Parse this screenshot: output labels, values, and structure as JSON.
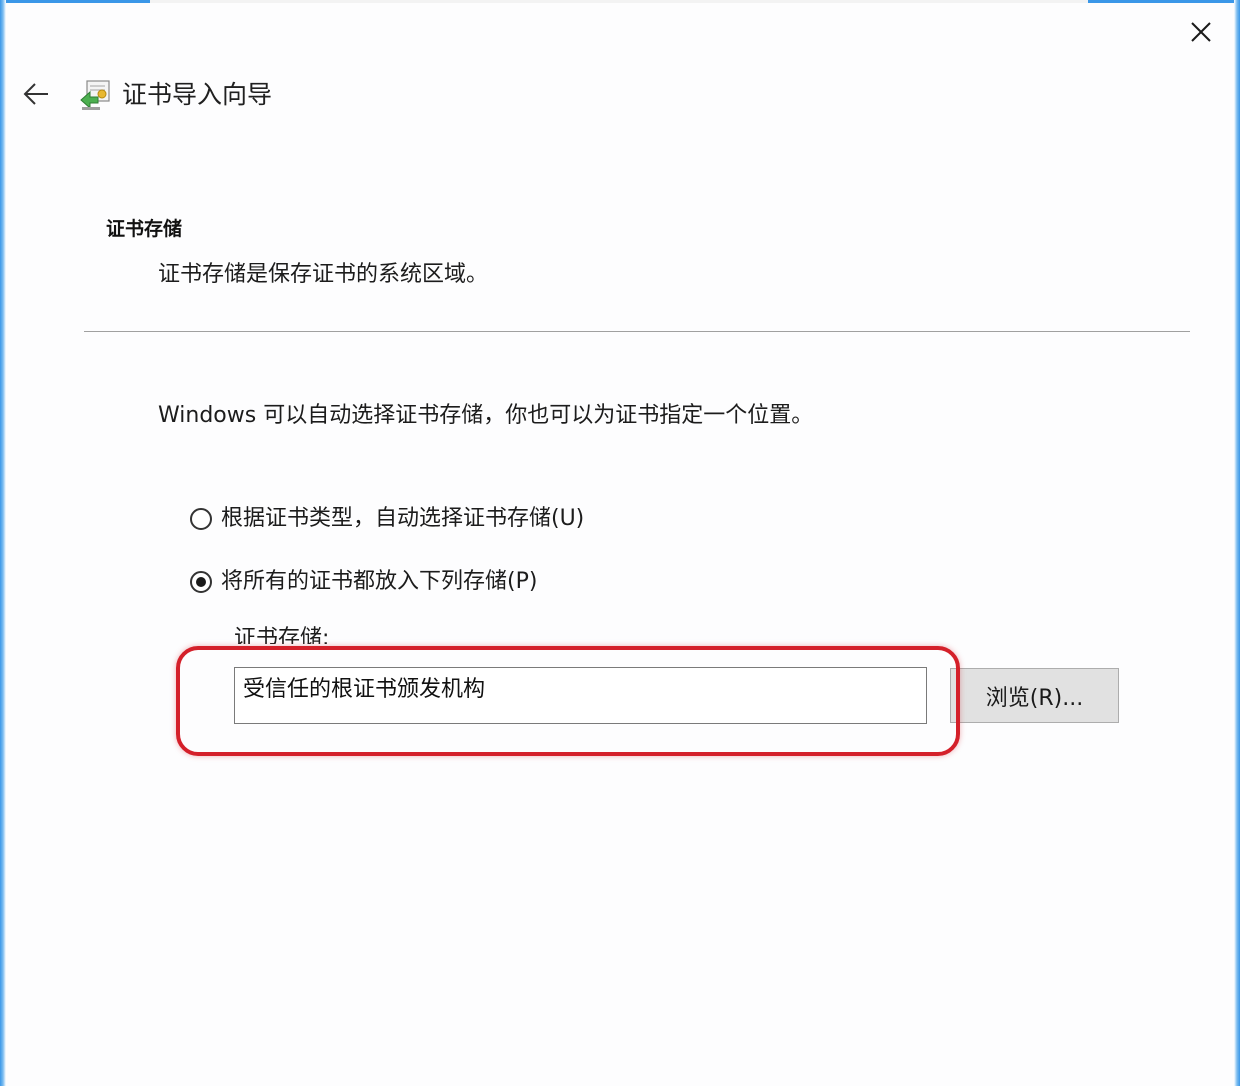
{
  "wizard": {
    "title": "证书导入向导"
  },
  "section": {
    "title": "证书存储",
    "description": "证书存储是保存证书的系统区域。"
  },
  "main": {
    "intro": "Windows 可以自动选择证书存储，你也可以为证书指定一个位置。",
    "options": [
      {
        "label": "根据证书类型，自动选择证书存储(U)",
        "selected": false
      },
      {
        "label": "将所有的证书都放入下列存储(P)",
        "selected": true
      }
    ],
    "store_label": "证书存储:",
    "store_value": "受信任的根证书颁发机构",
    "browse_label": "浏览(R)..."
  },
  "colors": {
    "window_border": "#3a97e8",
    "highlight": "#d4202a"
  },
  "icons": {
    "back": "arrow-left-icon",
    "close": "close-icon",
    "wizard": "certificate-wizard-icon"
  }
}
